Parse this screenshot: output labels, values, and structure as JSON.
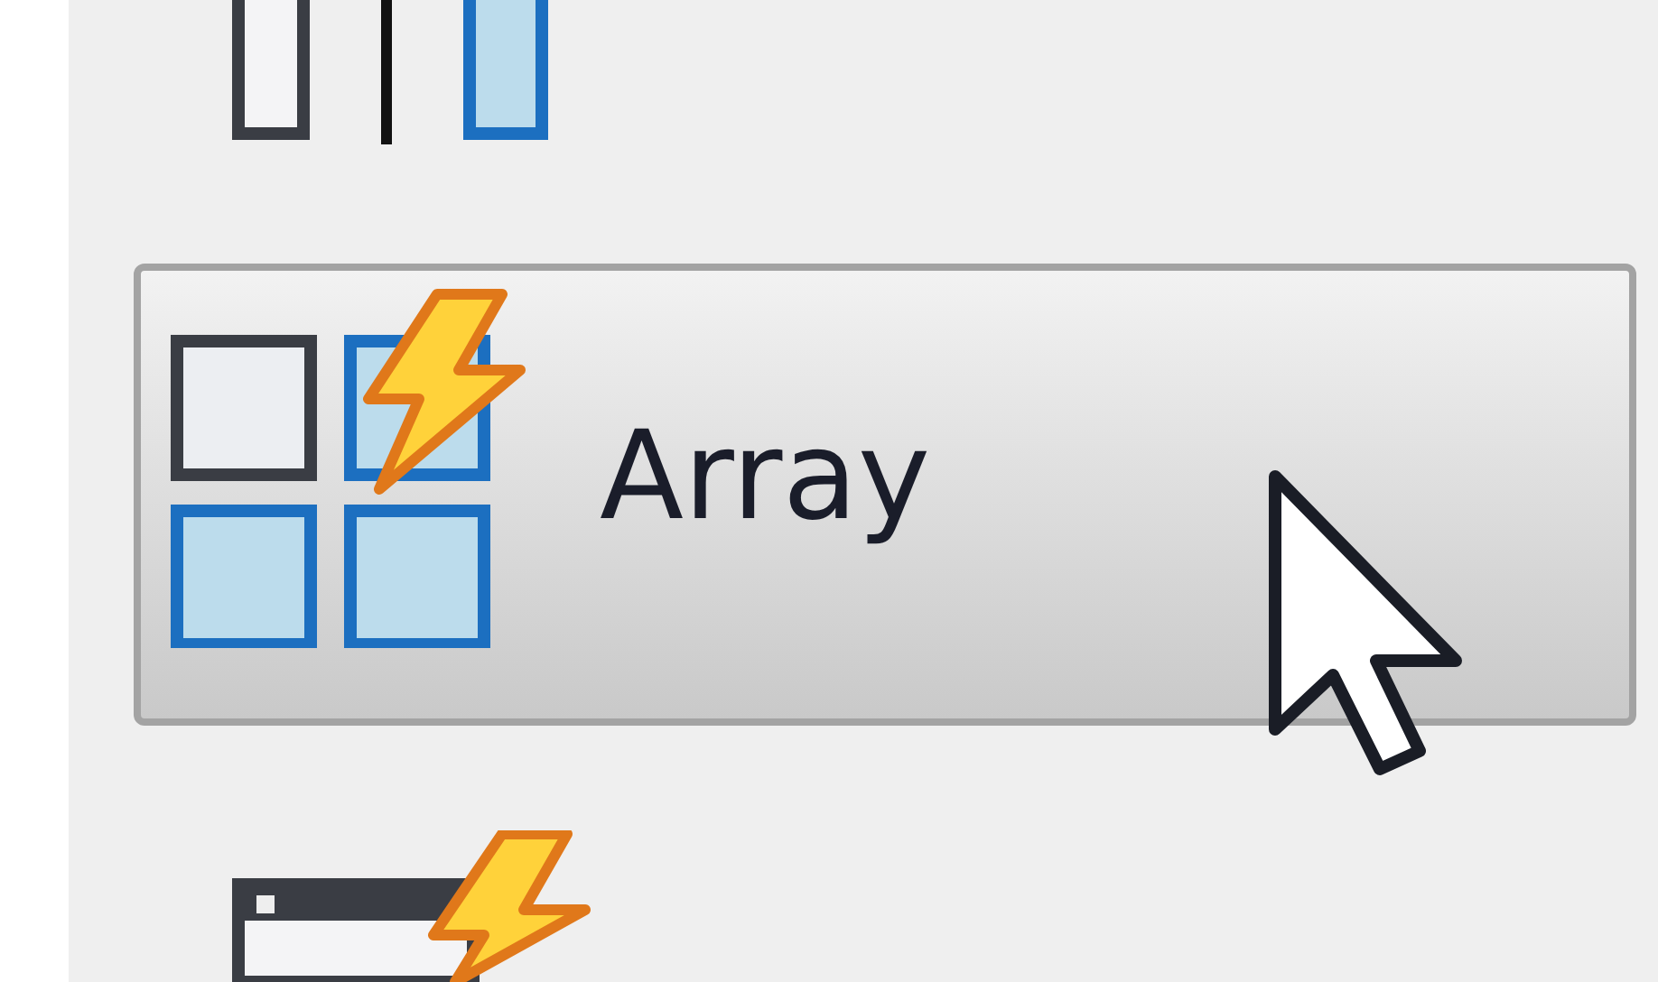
{
  "menu_items": [
    {
      "label": "Array",
      "hovered": true
    }
  ]
}
